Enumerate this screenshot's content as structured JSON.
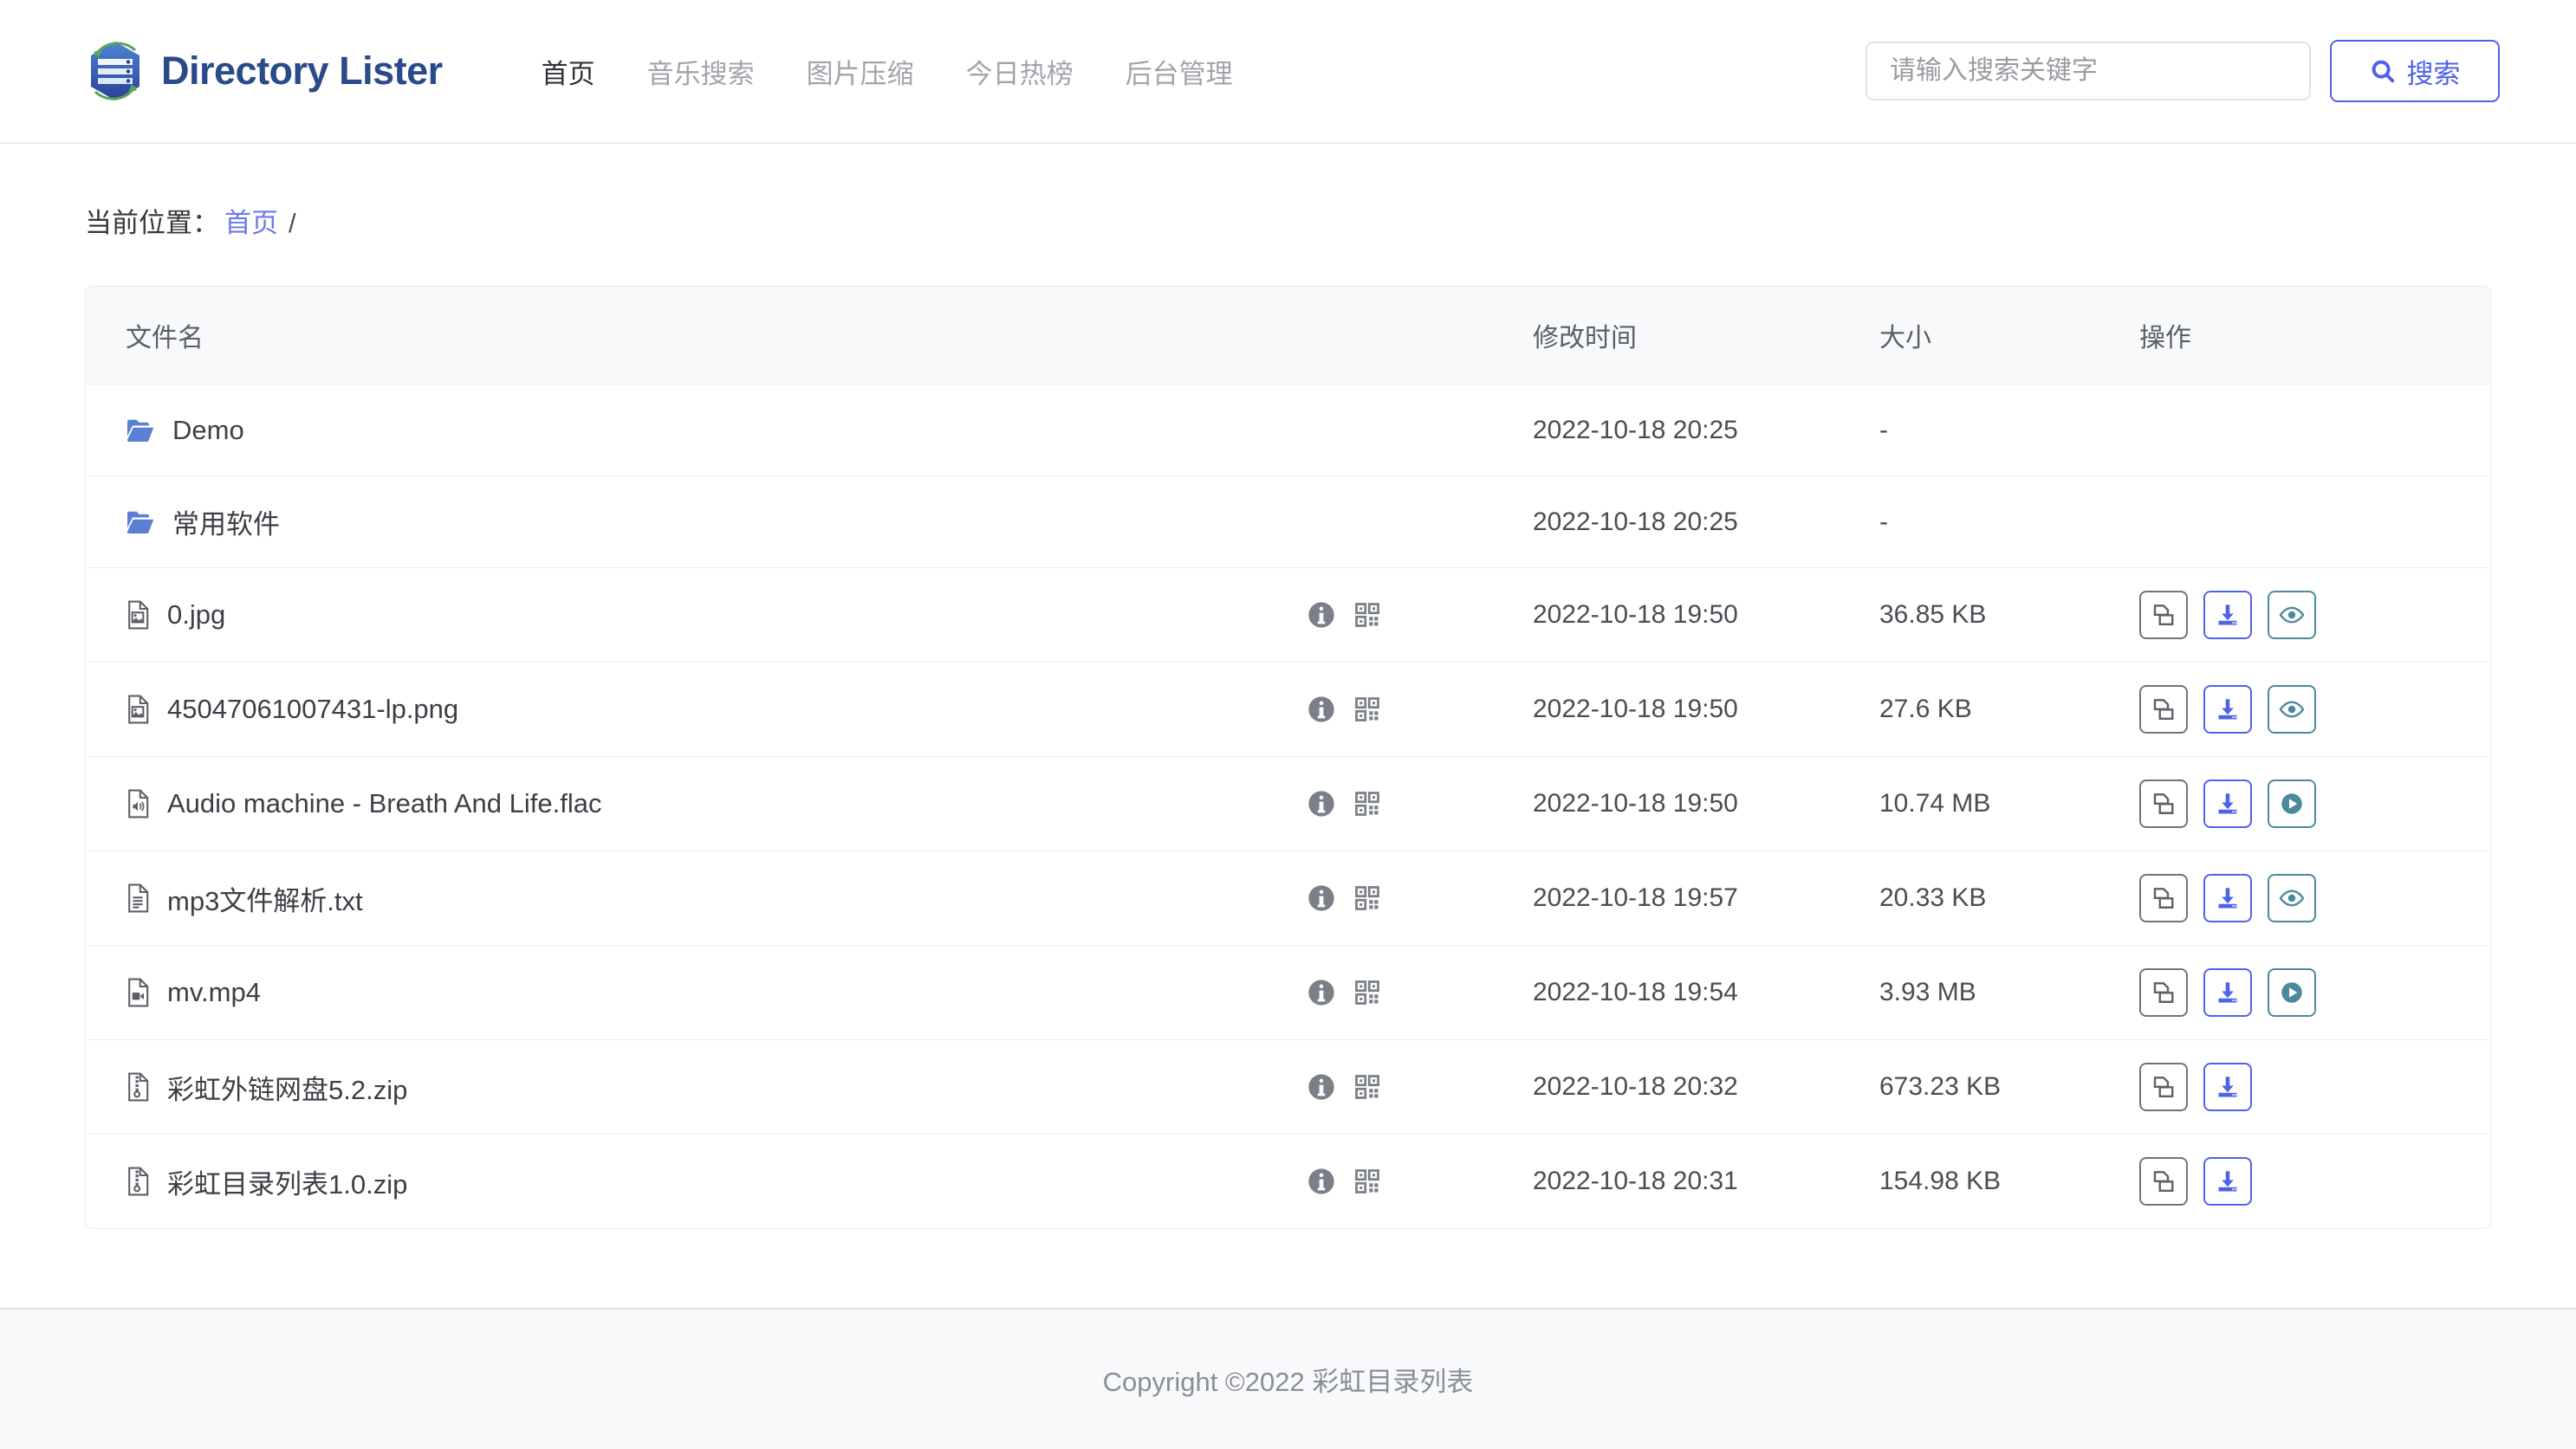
{
  "header": {
    "brand_name": "Directory Lister",
    "logo_icon": "directory-lister-logo",
    "nav": [
      {
        "label": "首页",
        "active": true
      },
      {
        "label": "音乐搜索",
        "active": false
      },
      {
        "label": "图片压缩",
        "active": false
      },
      {
        "label": "今日热榜",
        "active": false
      },
      {
        "label": "后台管理",
        "active": false
      }
    ],
    "search": {
      "placeholder": "请输入搜索关键字",
      "value": "",
      "button_label": "搜索",
      "button_icon": "search-icon"
    }
  },
  "breadcrumb": {
    "label": "当前位置：",
    "home_link": "首页",
    "separator": "/"
  },
  "table": {
    "columns": {
      "name": "文件名",
      "modified": "修改时间",
      "size": "大小",
      "actions": "操作"
    },
    "rows": [
      {
        "name": "Demo",
        "icon": "folder-icon",
        "modified": "2022-10-18 20:25",
        "size": "-",
        "has_meta": false,
        "actions": []
      },
      {
        "name": "常用软件",
        "icon": "folder-icon",
        "modified": "2022-10-18 20:25",
        "size": "-",
        "has_meta": false,
        "actions": []
      },
      {
        "name": "0.jpg",
        "icon": "file-image-icon",
        "modified": "2022-10-18 19:50",
        "size": "36.85 KB",
        "has_meta": true,
        "actions": [
          "copy",
          "download",
          "preview"
        ]
      },
      {
        "name": "45047061007431-lp.png",
        "icon": "file-image-icon",
        "modified": "2022-10-18 19:50",
        "size": "27.6 KB",
        "has_meta": true,
        "actions": [
          "copy",
          "download",
          "preview"
        ]
      },
      {
        "name": "Audio machine - Breath And Life.flac",
        "icon": "file-audio-icon",
        "modified": "2022-10-18 19:50",
        "size": "10.74 MB",
        "has_meta": true,
        "actions": [
          "copy",
          "download",
          "play"
        ]
      },
      {
        "name": "mp3文件解析.txt",
        "icon": "file-text-icon",
        "modified": "2022-10-18 19:57",
        "size": "20.33 KB",
        "has_meta": true,
        "actions": [
          "copy",
          "download",
          "preview"
        ]
      },
      {
        "name": "mv.mp4",
        "icon": "file-video-icon",
        "modified": "2022-10-18 19:54",
        "size": "3.93 MB",
        "has_meta": true,
        "actions": [
          "copy",
          "download",
          "play"
        ]
      },
      {
        "name": "彩虹外链网盘5.2.zip",
        "icon": "file-archive-icon",
        "modified": "2022-10-18 20:32",
        "size": "673.23 KB",
        "has_meta": true,
        "actions": [
          "copy",
          "download"
        ]
      },
      {
        "name": "彩虹目录列表1.0.zip",
        "icon": "file-archive-icon",
        "modified": "2022-10-18 20:31",
        "size": "154.98 KB",
        "has_meta": true,
        "actions": [
          "copy",
          "download"
        ]
      }
    ],
    "meta_icons": [
      "info-icon",
      "qrcode-icon"
    ]
  },
  "footer": {
    "text": "Copyright ©2022 彩虹目录列表"
  },
  "colors": {
    "brand": "#2b4a8b",
    "accent": "#4f63e8",
    "link": "#6b7ae8",
    "folder": "#5b7fd4",
    "preview": "#4b8a9e",
    "muted": "#9a9aa2",
    "header_bg": "#f8f9fa",
    "border": "#e9ecef"
  }
}
